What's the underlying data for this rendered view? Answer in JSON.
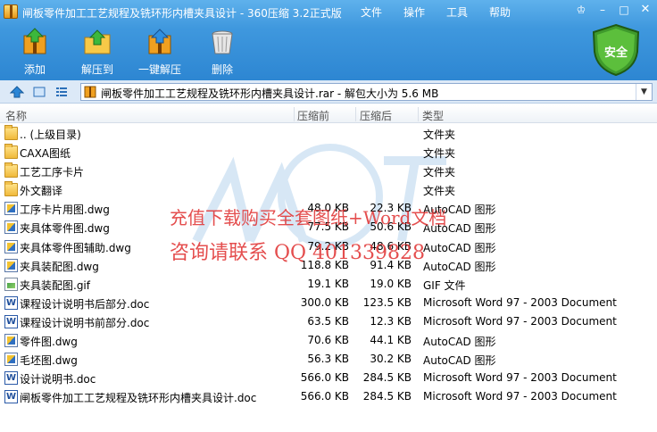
{
  "window": {
    "title": "闸板零件加工工艺规程及铣环形内槽夹具设计 - 360压缩 3.2正式版",
    "menus": [
      "文件",
      "操作",
      "工具",
      "帮助"
    ],
    "controls": [
      "♔",
      "–",
      "□",
      "✕"
    ]
  },
  "toolbar": {
    "add": "添加",
    "extract": "解压到",
    "one_click": "一键解压",
    "delete": "删除",
    "security": "安全"
  },
  "address": {
    "path": "闸板零件加工工艺规程及铣环形内槽夹具设计.rar - 解包大小为 5.6 MB"
  },
  "columns": {
    "name": "名称",
    "compressed": "压缩前",
    "original": "压缩后",
    "type": "类型"
  },
  "files": [
    {
      "name": ".. (上级目录)",
      "comp": "",
      "orig": "",
      "type": "文件夹",
      "icon": "folder"
    },
    {
      "name": "CAXA图纸",
      "comp": "",
      "orig": "",
      "type": "文件夹",
      "icon": "folder"
    },
    {
      "name": "工艺工序卡片",
      "comp": "",
      "orig": "",
      "type": "文件夹",
      "icon": "folder"
    },
    {
      "name": "外文翻译",
      "comp": "",
      "orig": "",
      "type": "文件夹",
      "icon": "folder"
    },
    {
      "name": "工序卡片用图.dwg",
      "comp": "48.0 KB",
      "orig": "22.3 KB",
      "type": "AutoCAD 图形",
      "icon": "dwg"
    },
    {
      "name": "夹具体零件图.dwg",
      "comp": "77.5 KB",
      "orig": "50.6 KB",
      "type": "AutoCAD 图形",
      "icon": "dwg"
    },
    {
      "name": "夹具体零件图辅助.dwg",
      "comp": "79.2 KB",
      "orig": "48.6 KB",
      "type": "AutoCAD 图形",
      "icon": "dwg"
    },
    {
      "name": "夹具装配图.dwg",
      "comp": "118.8 KB",
      "orig": "91.4 KB",
      "type": "AutoCAD 图形",
      "icon": "dwg"
    },
    {
      "name": "夹具装配图.gif",
      "comp": "19.1 KB",
      "orig": "19.0 KB",
      "type": "GIF 文件",
      "icon": "gif"
    },
    {
      "name": "课程设计说明书后部分.doc",
      "comp": "300.0 KB",
      "orig": "123.5 KB",
      "type": "Microsoft Word 97 - 2003 Document",
      "icon": "doc"
    },
    {
      "name": "课程设计说明书前部分.doc",
      "comp": "63.5 KB",
      "orig": "12.3 KB",
      "type": "Microsoft Word 97 - 2003 Document",
      "icon": "doc"
    },
    {
      "name": "零件图.dwg",
      "comp": "70.6 KB",
      "orig": "44.1 KB",
      "type": "AutoCAD 图形",
      "icon": "dwg"
    },
    {
      "name": "毛坯图.dwg",
      "comp": "56.3 KB",
      "orig": "30.2 KB",
      "type": "AutoCAD 图形",
      "icon": "dwg"
    },
    {
      "name": "设计说明书.doc",
      "comp": "566.0 KB",
      "orig": "284.5 KB",
      "type": "Microsoft Word 97 - 2003 Document",
      "icon": "doc"
    },
    {
      "name": "闸板零件加工工艺规程及铣环形内槽夹具设计.doc",
      "comp": "566.0 KB",
      "orig": "284.5 KB",
      "type": "Microsoft Word 97 - 2003 Document",
      "icon": "doc"
    }
  ],
  "watermark": {
    "line1": "充值下载购买全套图纸+Word文档",
    "line2": "咨询请联系  QQ 401339828"
  }
}
